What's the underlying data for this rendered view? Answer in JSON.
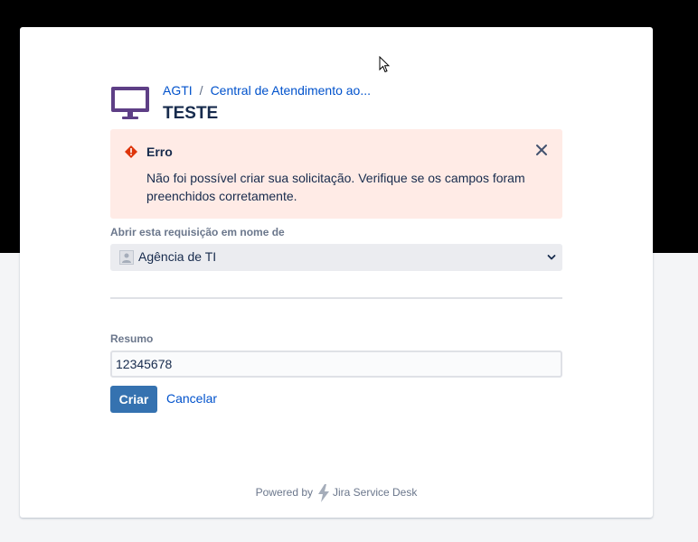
{
  "breadcrumb": {
    "root": "AGTI",
    "separator": "/",
    "portal": "Central de Atendimento ao..."
  },
  "page": {
    "title": "TESTE",
    "icon": "monitor-icon"
  },
  "error": {
    "title": "Erro",
    "message": "Não foi possível criar sua solicitação. Verifique se os campos foram preenchidos corretamente.",
    "icon": "error-icon",
    "close_icon": "close-icon"
  },
  "on_behalf": {
    "label": "Abrir esta requisição em nome de",
    "value": "Agência de TI"
  },
  "summary": {
    "label": "Resumo",
    "value": "12345678"
  },
  "actions": {
    "submit": "Criar",
    "cancel": "Cancelar"
  },
  "footer": {
    "prefix": "Powered by",
    "product": "Jira Service Desk"
  },
  "colors": {
    "primary_button": "#3572b0",
    "link": "#0052cc",
    "error_background": "#ffebe6",
    "error_icon": "#de350b",
    "portal_icon": "#5e3f86"
  }
}
